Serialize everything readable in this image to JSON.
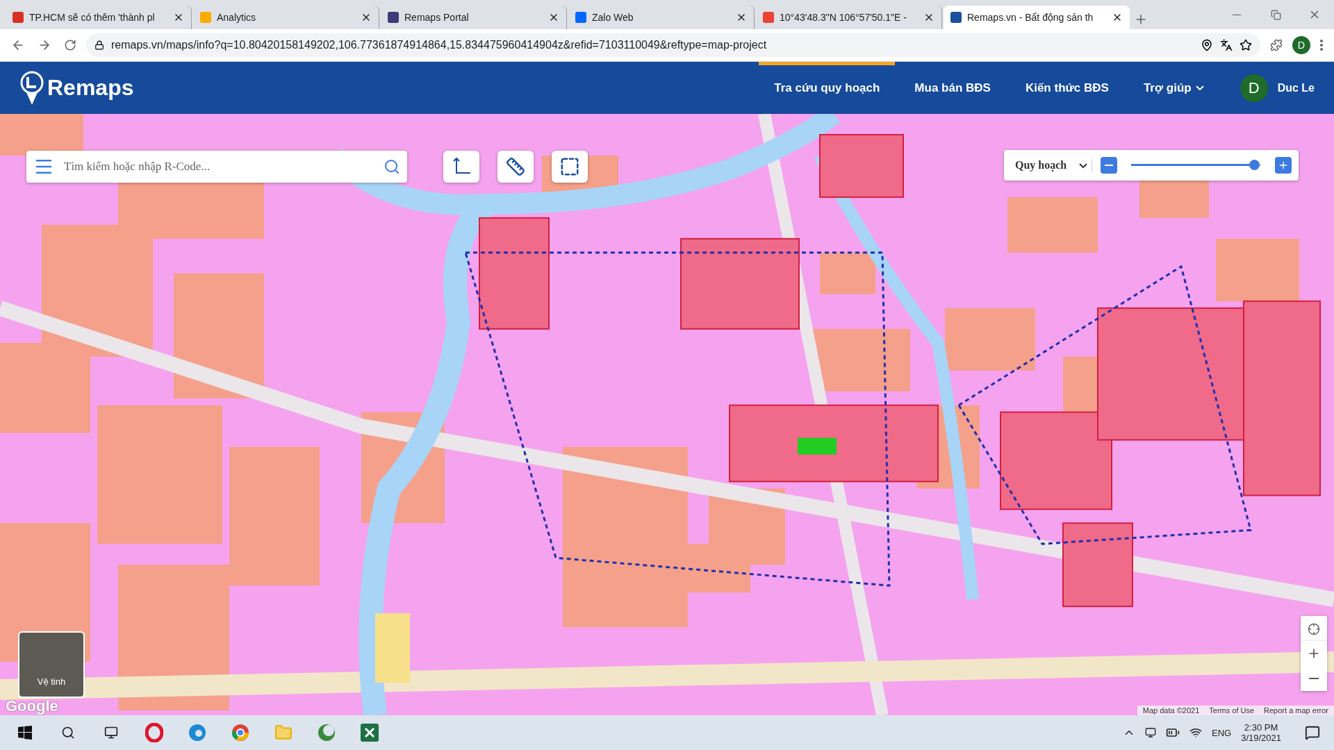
{
  "browser": {
    "tabs": [
      {
        "title": "TP.HCM sẽ có thêm 'thành pl",
        "color": "#d93025",
        "selected": false
      },
      {
        "title": "Analytics",
        "color": "#f9ab00",
        "selected": false
      },
      {
        "title": "Remaps Portal",
        "color": "#3c3a7a",
        "selected": false
      },
      {
        "title": "Zalo Web",
        "color": "#0068ff",
        "selected": false
      },
      {
        "title": "10°43'48.3\"N 106°57'50.1\"E -",
        "color": "#ea4335",
        "selected": false
      },
      {
        "title": "Remaps.vn - Bất động sản th",
        "color": "#1a4fa0",
        "selected": true
      }
    ],
    "url": "remaps.vn/maps/info?q=10.80420158149202,106.77361874914864,15.834475960414904z&refid=7103110049&reftype=map-project",
    "profile_initial": "D"
  },
  "app": {
    "logo": "Remaps",
    "nav": [
      {
        "label": "Tra cứu quy hoạch",
        "selected": true,
        "has_menu": false
      },
      {
        "label": "Mua bán BĐS",
        "selected": false,
        "has_menu": false
      },
      {
        "label": "Kiến thức BĐS",
        "selected": false,
        "has_menu": false
      },
      {
        "label": "Trợ giúp",
        "selected": false,
        "has_menu": true
      }
    ],
    "user": {
      "initial": "D",
      "name": "Duc Le"
    }
  },
  "map": {
    "search": {
      "placeholder": "Tìm kiếm hoặc nhập R-Code..."
    },
    "layer": "Quy hoạch",
    "opacity": {
      "level": 0.95
    },
    "satellite_label": "Vệ tinh",
    "google": "Google",
    "attribution": [
      "Map data ©2021",
      "Terms of Use",
      "Report a map error"
    ]
  },
  "taskbar": {
    "language": "ENG",
    "time": "2:30 PM",
    "date": "3/19/2021"
  }
}
